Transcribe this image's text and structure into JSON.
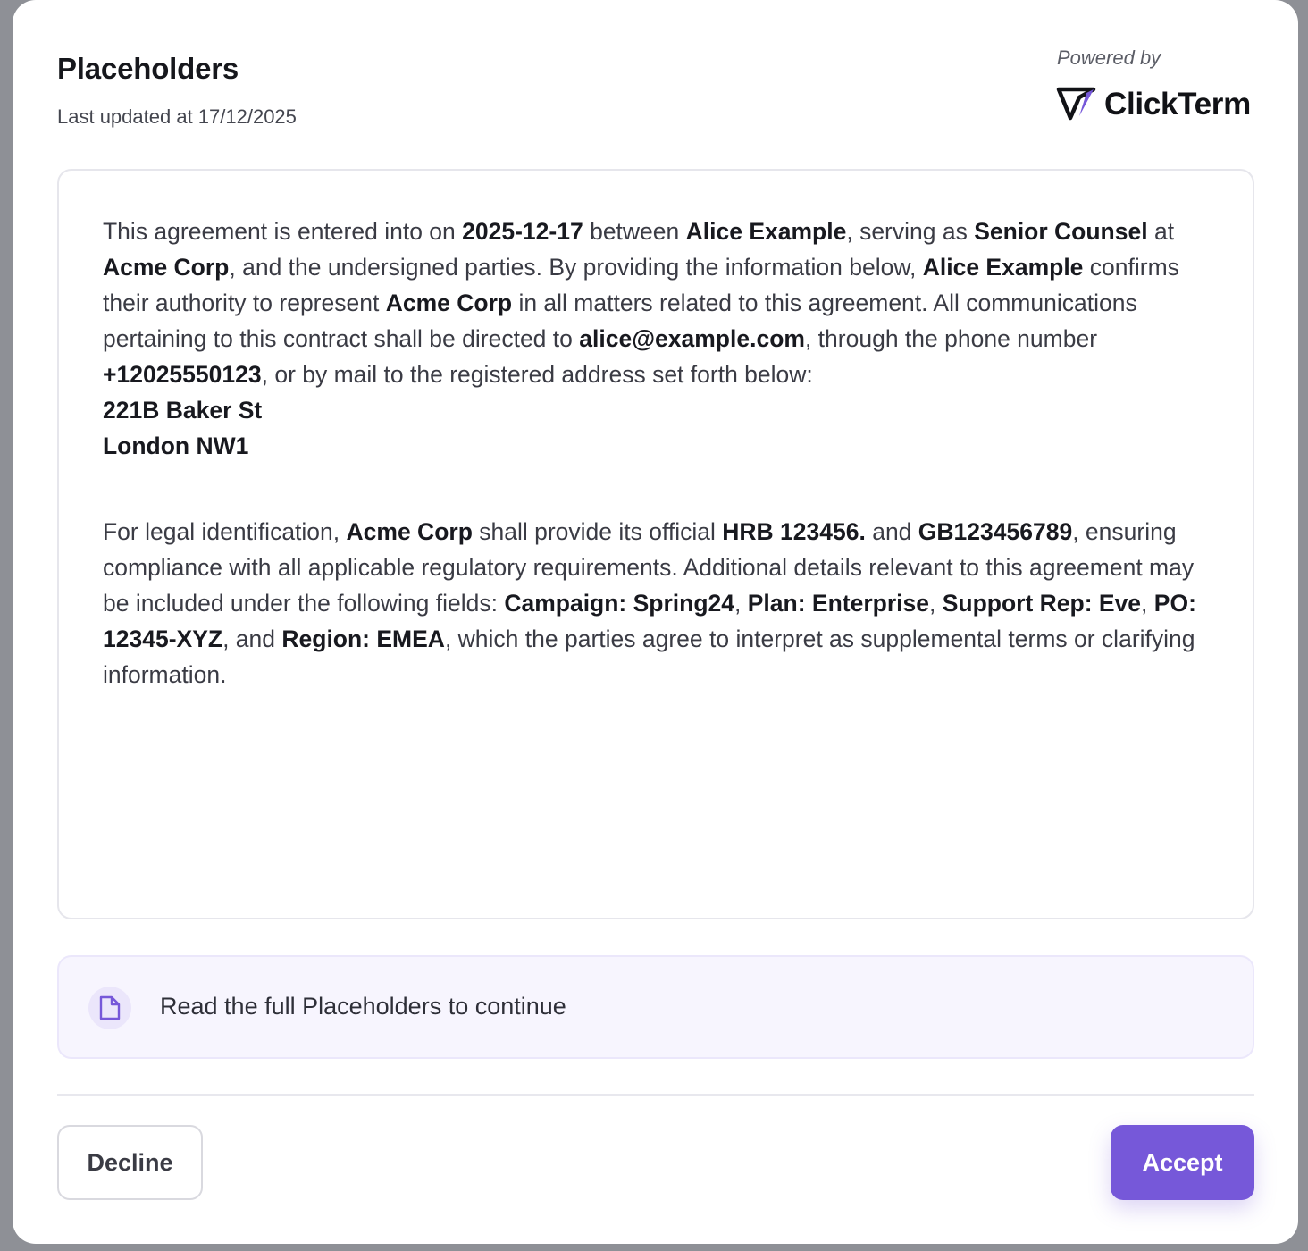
{
  "header": {
    "title": "Placeholders",
    "last_updated": "Last updated at 17/12/2025",
    "powered_by": "Powered by",
    "brand_name": "ClickTerm"
  },
  "agreement": {
    "p1": {
      "t1": "This agreement is entered into on ",
      "date": "2025-12-17",
      "t2": " between ",
      "name1": "Alice Example",
      "t3": ", serving as ",
      "role": "Senior Counsel",
      "t4": " at ",
      "company1": "Acme Corp",
      "t5": ", and the undersigned parties. By providing the information below, ",
      "name2": "Alice Example",
      "t6": " confirms their authority to represent ",
      "company2": "Acme Corp",
      "t7": " in all matters related to this agreement. All communications pertaining to this contract shall be directed to ",
      "email": "alice@example.com",
      "t8": ", through the phone number ",
      "phone": "+12025550123",
      "t9": ", or by mail to the registered address set forth below:",
      "address_line1": "221B Baker St",
      "address_line2": "London NW1"
    },
    "p2": {
      "t1": "For legal identification, ",
      "company": "Acme Corp",
      "t2": " shall provide its official ",
      "registration": "HRB 123456.",
      "t3": " and ",
      "vat": "GB123456789",
      "t4": ", ensuring compliance with all applicable regulatory requirements. Additional details relevant to this agreement may be included under the following fields: ",
      "field1": "Campaign: Spring24",
      "t5": ", ",
      "field2": "Plan: Enterprise",
      "t6": ", ",
      "field3": "Support Rep: Eve",
      "t7": ", ",
      "field4": "PO: 12345-XYZ",
      "t8": ", and ",
      "field5": "Region: EMEA",
      "t9": ", which the parties agree to interpret as supplemental terms or clarifying information."
    }
  },
  "notice": {
    "icon": "document-icon",
    "text": "Read the full Placeholders to continue"
  },
  "actions": {
    "decline_label": "Decline",
    "accept_label": "Accept"
  },
  "colors": {
    "accent": "#7658d9",
    "notice_bg": "#f7f5fe",
    "backdrop": "#8e9096"
  }
}
